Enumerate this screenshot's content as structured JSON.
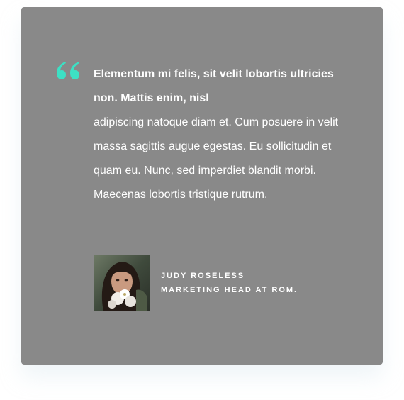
{
  "testimonial": {
    "headline": "Elementum mi felis, sit velit lobortis ultricies non. Mattis enim, nisl",
    "body": "adipiscing natoque diam et. Cum posuere in velit massa sagittis augue egestas. Eu sollicitudin et quam eu. Nunc, sed imperdiet blandit morbi. Maecenas lobortis tristique rutrum.",
    "quote_icon": "quote-open-icon",
    "author": {
      "name": "JUDY ROSELESS",
      "title": "MARKETING HEAD AT ROM.",
      "avatar": "avatar-photo"
    }
  },
  "colors": {
    "card_background": "#898989",
    "accent": "#3de0c4",
    "text": "#ffffff"
  }
}
